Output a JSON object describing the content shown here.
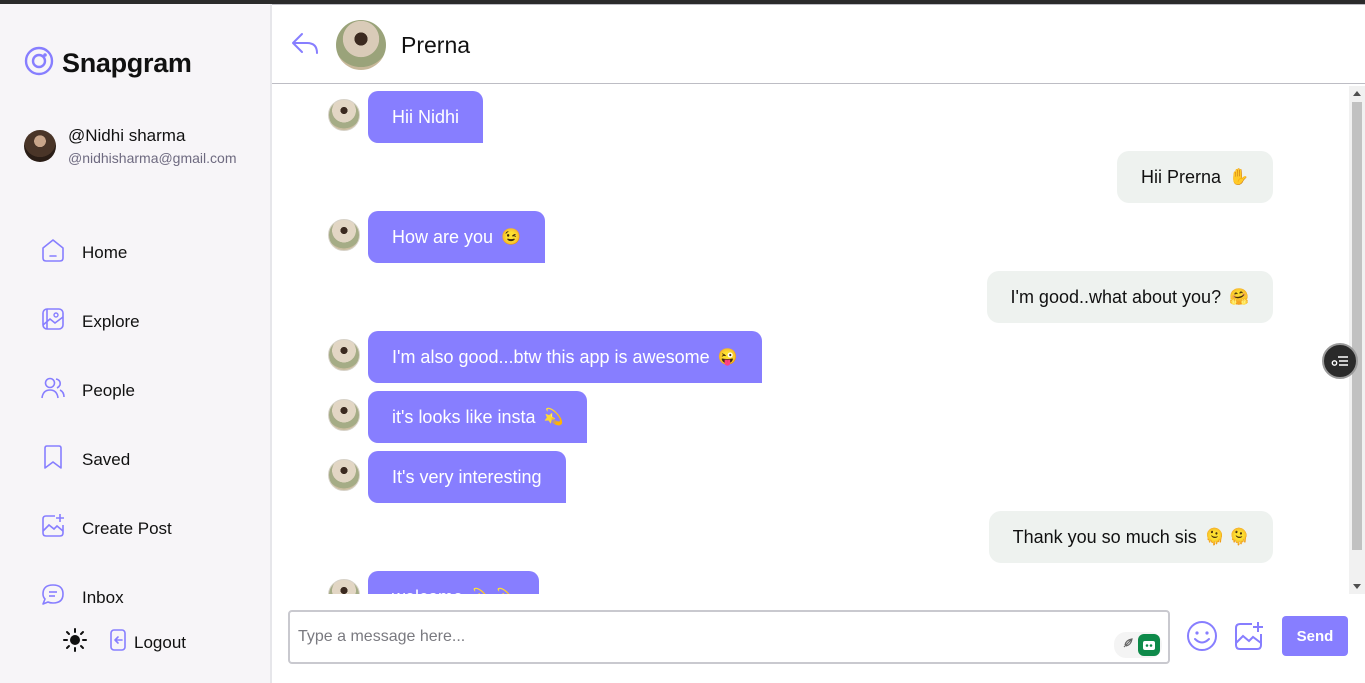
{
  "app": {
    "name": "Snapgram",
    "accent": "#877eff"
  },
  "user": {
    "name": "@Nidhi sharma",
    "email": "@nidhisharma@gmail.com"
  },
  "nav": [
    {
      "label": "Home",
      "icon": "home-icon"
    },
    {
      "label": "Explore",
      "icon": "explore-icon"
    },
    {
      "label": "People",
      "icon": "people-icon"
    },
    {
      "label": "Saved",
      "icon": "bookmark-icon"
    },
    {
      "label": "Create Post",
      "icon": "create-post-icon"
    },
    {
      "label": "Inbox",
      "icon": "chat-icon"
    }
  ],
  "logout_label": "Logout",
  "chat": {
    "contact_name": "Prerna",
    "messages": [
      {
        "from": "them",
        "text": "Hii Nidhi",
        "emoji": ""
      },
      {
        "from": "me",
        "text": "Hii Prerna",
        "emoji": "✋"
      },
      {
        "from": "them",
        "text": "How are you",
        "emoji": "😉"
      },
      {
        "from": "me",
        "text": "I'm good..what about you?",
        "emoji": "🤗"
      },
      {
        "from": "them",
        "text": "I'm also good...btw this app is awesome",
        "emoji": "😜"
      },
      {
        "from": "them",
        "text": "it's looks like insta",
        "emoji": "💫"
      },
      {
        "from": "them",
        "text": "It's very interesting",
        "emoji": ""
      },
      {
        "from": "me",
        "text": "Thank you so much sis",
        "emoji": "🫠 🫠"
      },
      {
        "from": "them",
        "text": "welcome",
        "emoji": "💫 💫"
      }
    ]
  },
  "composer": {
    "placeholder": "Type a message here...",
    "send_label": "Send"
  }
}
